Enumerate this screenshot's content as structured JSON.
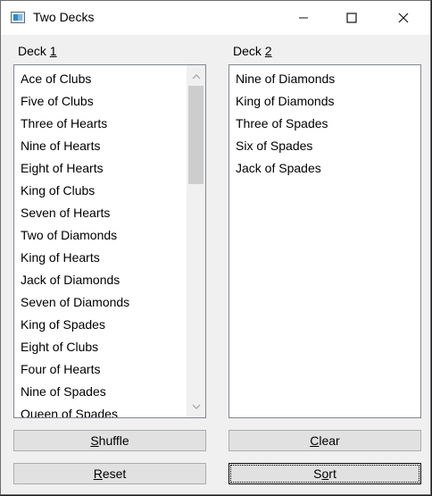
{
  "window": {
    "title": "Two Decks"
  },
  "deck1": {
    "label": {
      "before": "Deck ",
      "accel": "1"
    },
    "items": [
      "Ace of Clubs",
      "Five of Clubs",
      "Three of Hearts",
      "Nine of Hearts",
      "Eight of Hearts",
      "King of Clubs",
      "Seven of Hearts",
      "Two of Diamonds",
      "King of Hearts",
      "Jack of Diamonds",
      "Seven of Diamonds",
      "King of Spades",
      "Eight of Clubs",
      "Four of Hearts",
      "Nine of Spades",
      "Queen of Spades"
    ]
  },
  "deck2": {
    "label": {
      "before": "Deck ",
      "accel": "2"
    },
    "items": [
      "Nine of Diamonds",
      "King of Diamonds",
      "Three of Spades",
      "Six of Spades",
      "Jack of Spades"
    ]
  },
  "buttons": {
    "shuffle": {
      "accel": "S",
      "rest": "huffle"
    },
    "clear": {
      "accel": "C",
      "rest": "lear"
    },
    "reset": {
      "accel": "R",
      "rest": "eset"
    },
    "sort": {
      "before": "S",
      "accel": "o",
      "rest": "rt"
    }
  },
  "icons": {
    "app": "app-window-icon",
    "minimize": "minimize-icon",
    "maximize": "maximize-icon",
    "close": "close-icon",
    "scroll_up": "chevron-up-icon",
    "scroll_down": "chevron-down-icon"
  },
  "colors": {
    "window_bg": "#f0f0f0",
    "button_bg": "#e1e1e1",
    "list_border": "#828790",
    "scroll_thumb": "#cdcdcd"
  }
}
